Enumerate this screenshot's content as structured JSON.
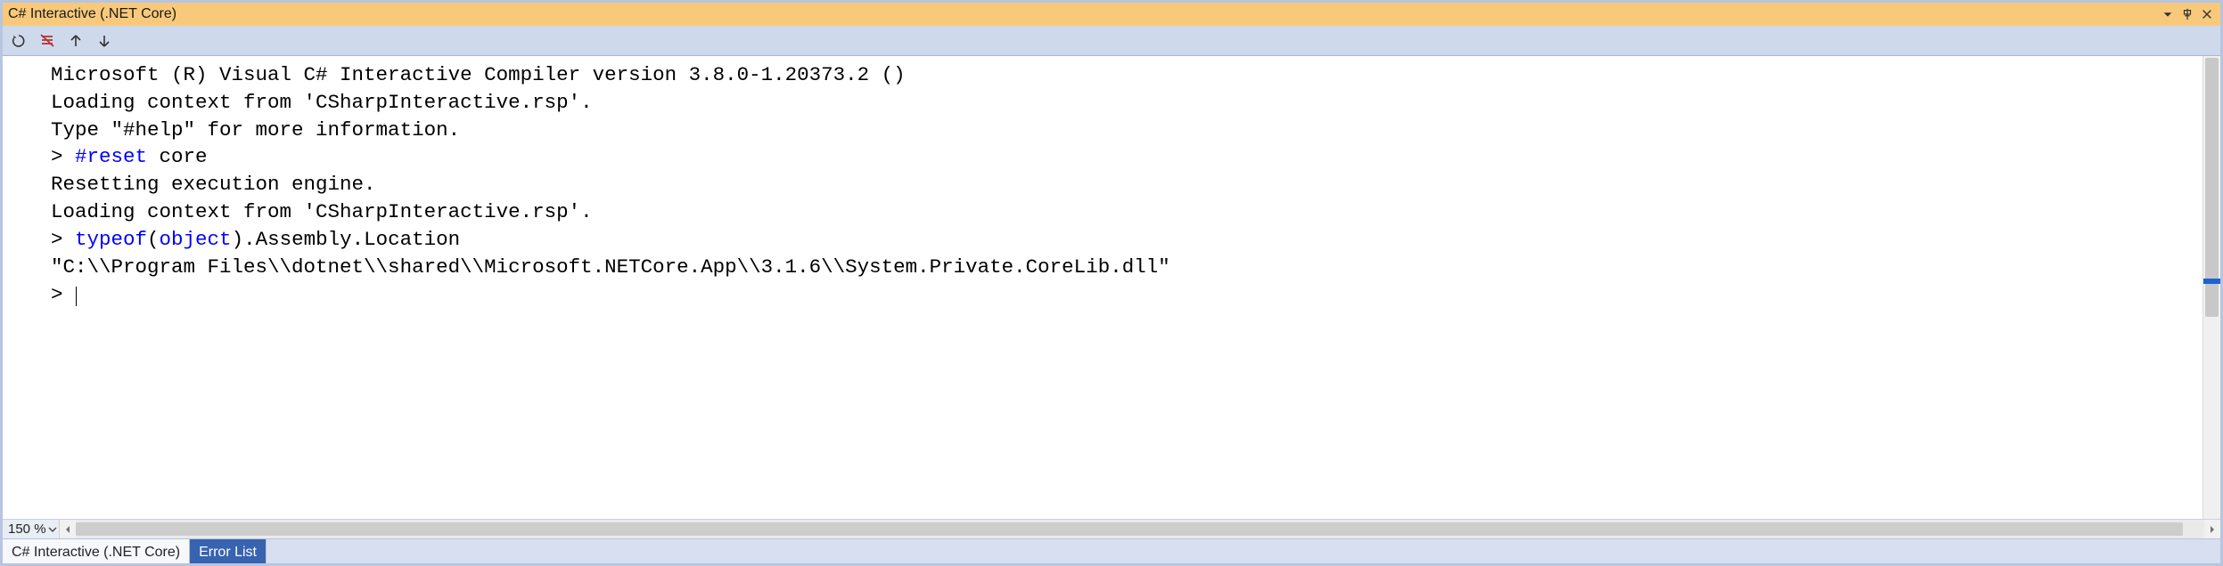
{
  "window": {
    "title": "C# Interactive (.NET Core)"
  },
  "toolbar": {
    "reset_tooltip": "Reset",
    "clear_tooltip": "Clear Screen",
    "up_tooltip": "History Previous",
    "down_tooltip": "History Next"
  },
  "console": {
    "line1": "Microsoft (R) Visual C# Interactive Compiler version 3.8.0-1.20373.2 ()",
    "line2": "Loading context from 'CSharpInteractive.rsp'.",
    "line3": "Type \"#help\" for more information.",
    "prompt": "> ",
    "reset_cmd": "#reset",
    "reset_arg": " core",
    "line5": "Resetting execution engine.",
    "line6": "Loading context from 'CSharpInteractive.rsp'.",
    "typeof_kw": "typeof",
    "typeof_open": "(",
    "object_kw": "object",
    "typeof_rest": ").Assembly.Location",
    "line8": "\"C:\\\\Program Files\\\\dotnet\\\\shared\\\\Microsoft.NETCore.App\\\\3.1.6\\\\System.Private.CoreLib.dll\""
  },
  "status": {
    "zoom": "150 %"
  },
  "tabs": {
    "active": "C# Interactive (.NET Core)",
    "inactive": "Error List"
  }
}
